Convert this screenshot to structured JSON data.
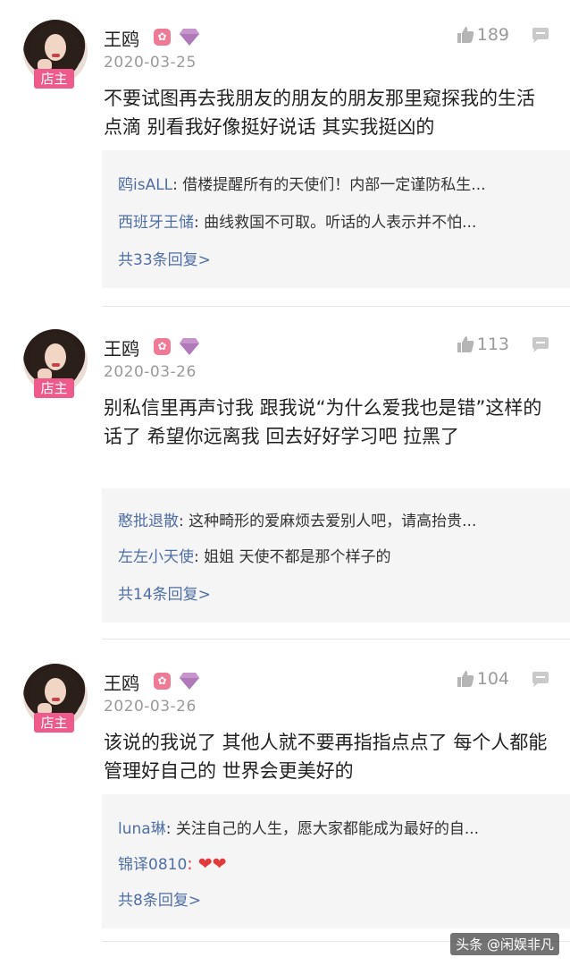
{
  "posts": [
    {
      "username": "王鸥",
      "store_badge": "店主",
      "date": "2020-03-25",
      "likes": "189",
      "content": "不要试图再去我朋友的朋友的朋友那里窥探我的生活点滴 别看我好像挺好说话 其实我挺凶的",
      "replies": [
        {
          "user": "鸥isALL",
          "text": ": 借楼提醒所有的天使们！内部一定谨防私生..."
        },
        {
          "user": "西班牙王储",
          "text": ": 曲线救国不可取。听话的人表示并不怕..."
        }
      ],
      "more": "共33条回复>"
    },
    {
      "username": "王鸥",
      "store_badge": "店主",
      "date": "2020-03-26",
      "likes": "113",
      "content": "别私信里再声讨我 跟我说“为什么爱我也是错”这样的话了 希望你远离我 回去好好学习吧 拉黑了",
      "replies": [
        {
          "user": "憨批退散",
          "text": ": 这种畸形的爱麻烦去爱别人吧，请高抬贵..."
        },
        {
          "user": "左左小天使",
          "text": ": 姐姐 天使不都是那个样子的"
        }
      ],
      "more": "共14条回复>"
    },
    {
      "username": "王鸥",
      "store_badge": "店主",
      "date": "2020-03-26",
      "likes": "104",
      "content": "该说的我说了 其他人就不要再指指点点了 每个人都能管理好自己的 世界会更美好的",
      "replies": [
        {
          "user": "luna琳",
          "text": ": 关注自己的人生，愿大家都能成为最好的自..."
        },
        {
          "user": "锦译0810",
          "text": ": ❤❤"
        }
      ],
      "more": "共8条回复>"
    }
  ],
  "watermark": "头条 @闲娱非凡",
  "colors": {
    "reply_user": "#4e6fa6",
    "badge": "#ee5a8c",
    "gem": "#b07ab8"
  }
}
